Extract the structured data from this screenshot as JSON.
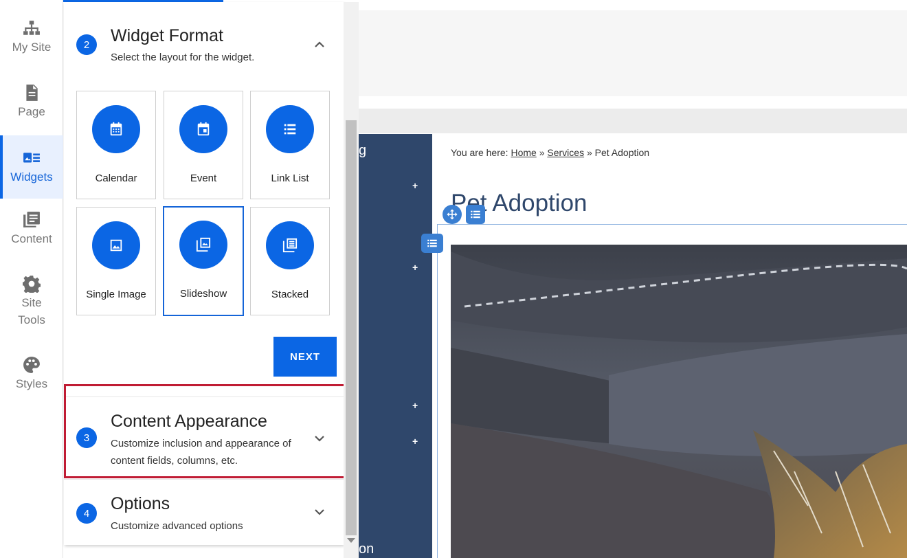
{
  "rail": {
    "items": [
      {
        "label": "My Site",
        "icon": "sitemap-icon"
      },
      {
        "label": "Page",
        "icon": "page-icon"
      },
      {
        "label": "Widgets",
        "icon": "widgets-icon",
        "active": true
      },
      {
        "label": "Content",
        "icon": "content-icon"
      },
      {
        "label_line1": "Site",
        "label_line2": "Tools",
        "icon": "gear-icon"
      },
      {
        "label": "Styles",
        "icon": "palette-icon"
      }
    ]
  },
  "panel": {
    "step2": {
      "number": "2",
      "title": "Widget Format",
      "subtitle": "Select the layout for the widget."
    },
    "formats": [
      {
        "label": "Calendar",
        "icon": "calendar-icon"
      },
      {
        "label": "Event",
        "icon": "event-icon"
      },
      {
        "label": "Link List",
        "icon": "link-list-icon"
      },
      {
        "label": "Single Image",
        "icon": "image-icon"
      },
      {
        "label": "Slideshow",
        "icon": "slideshow-icon",
        "selected": true
      },
      {
        "label": "Stacked",
        "icon": "stacked-icon"
      }
    ],
    "next_label": "NEXT",
    "step3": {
      "number": "3",
      "title": "Content Appearance",
      "subtitle_line1": "Customize inclusion and appearance of",
      "subtitle_line2": "content fields, columns, etc."
    },
    "step4": {
      "number": "4",
      "title": "Options",
      "subtitle": "Customize advanced options"
    }
  },
  "site": {
    "breadcrumb": {
      "prefix": "You are here:",
      "home": "Home",
      "sep": "»",
      "services": " Services",
      "current": "Pet Adoption"
    },
    "heading": "Pet Adoption",
    "nav_fragments": {
      "top": "g",
      "bottom": "on"
    },
    "nav_plus": "+"
  },
  "colors": {
    "accent": "#0b66e4",
    "highlight": "#c01c34",
    "site_nav": "#2f476b"
  }
}
